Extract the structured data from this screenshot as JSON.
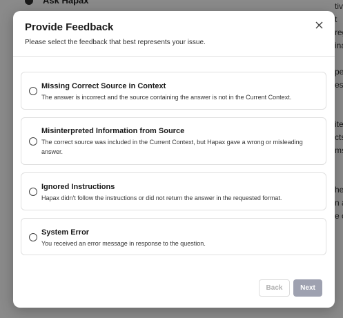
{
  "background": {
    "top_label": "Ask Hapax",
    "right_fragments": [
      "tiv",
      "t",
      "reg",
      "ina",
      "",
      "pe",
      "esl",
      "",
      "",
      "ite",
      "cts",
      "ms",
      "",
      "",
      "he",
      "n a",
      "e o"
    ]
  },
  "modal": {
    "title": "Provide Feedback",
    "subtitle": "Please select the feedback that best represents your issue.",
    "close_icon": "close-icon",
    "options": [
      {
        "title": "Missing Correct Source in Context",
        "description": "The answer is incorrect and the source containing the answer is not in the Current Context.",
        "selected": false
      },
      {
        "title": "Misinterpreted Information from Source",
        "description": "The correct source was included in the Current Context, but Hapax gave a wrong or misleading answer.",
        "selected": false
      },
      {
        "title": "Ignored Instructions",
        "description": "Hapax didn't follow the instructions or did not return the answer in the requested format.",
        "selected": false
      },
      {
        "title": "System Error",
        "description": "You received an error message in response to the question.",
        "selected": false
      }
    ],
    "back_label": "Back",
    "next_label": "Next"
  },
  "colors": {
    "overlay": "#000000",
    "next_button": "#9ea1b0",
    "border": "#e0e0e0"
  }
}
